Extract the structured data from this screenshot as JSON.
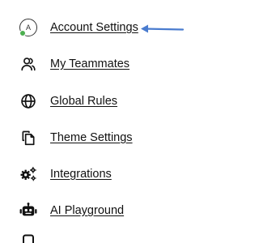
{
  "menu": {
    "items": [
      {
        "label": "Account Settings",
        "icon": "account-avatar-icon",
        "avatar_letter": "A",
        "status_color": "#4caf50"
      },
      {
        "label": "My Teammates",
        "icon": "teammates-icon"
      },
      {
        "label": "Global Rules",
        "icon": "globe-icon"
      },
      {
        "label": "Theme Settings",
        "icon": "copy-pages-icon"
      },
      {
        "label": "Integrations",
        "icon": "gears-icon"
      },
      {
        "label": "AI Playground",
        "icon": "robot-icon"
      }
    ]
  },
  "annotation": {
    "arrow_color": "#4a7ccf",
    "points_to": "Account Settings"
  }
}
